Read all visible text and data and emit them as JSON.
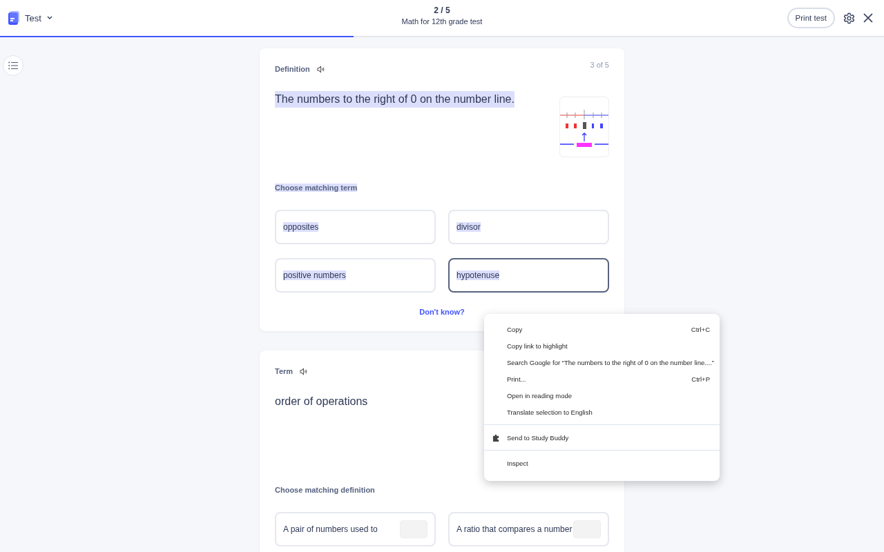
{
  "header": {
    "title": "Test",
    "progress": "2 / 5",
    "subtitle": "Math for 12th grade test",
    "print_button": "Print test",
    "level": 0.4
  },
  "cards": [
    {
      "label": "Definition",
      "counter": "3 of 5",
      "prompt": "The numbers to the right of 0 on the number line.",
      "illustrated": true,
      "instruction": "Choose matching term",
      "highlighted": true,
      "options": [
        {
          "text": "opposites",
          "hovered": false,
          "has_image": false
        },
        {
          "text": "divisor",
          "hovered": false,
          "has_image": false
        },
        {
          "text": "positive numbers",
          "hovered": false,
          "has_image": false
        },
        {
          "text": "hypotenuse",
          "hovered": true,
          "has_image": false
        }
      ],
      "link": "Don't know?"
    },
    {
      "label": "Term",
      "prompt": "order of operations",
      "illustrated": false,
      "instruction": "Choose matching definition",
      "highlighted": false,
      "options": [
        {
          "text": "A pair of numbers used to",
          "hovered": false,
          "has_image": true
        },
        {
          "text": "A ratio that compares a number",
          "hovered": false,
          "has_image": true
        }
      ]
    }
  ],
  "context_menu": {
    "sections": [
      [
        {
          "label": "Copy",
          "shortcut": "Ctrl+C"
        },
        {
          "label": "Copy link to highlight"
        },
        {
          "label": "Search Google for “The numbers to the right of 0 on the number line....”"
        },
        {
          "label": "Print...",
          "shortcut": "Ctrl+P"
        },
        {
          "label": "Open in reading mode"
        },
        {
          "label": "Translate selection to English"
        }
      ],
      [
        {
          "label": "Send to Study Buddy",
          "kind": "extension"
        }
      ],
      [
        {
          "label": "Inspect"
        }
      ]
    ]
  }
}
